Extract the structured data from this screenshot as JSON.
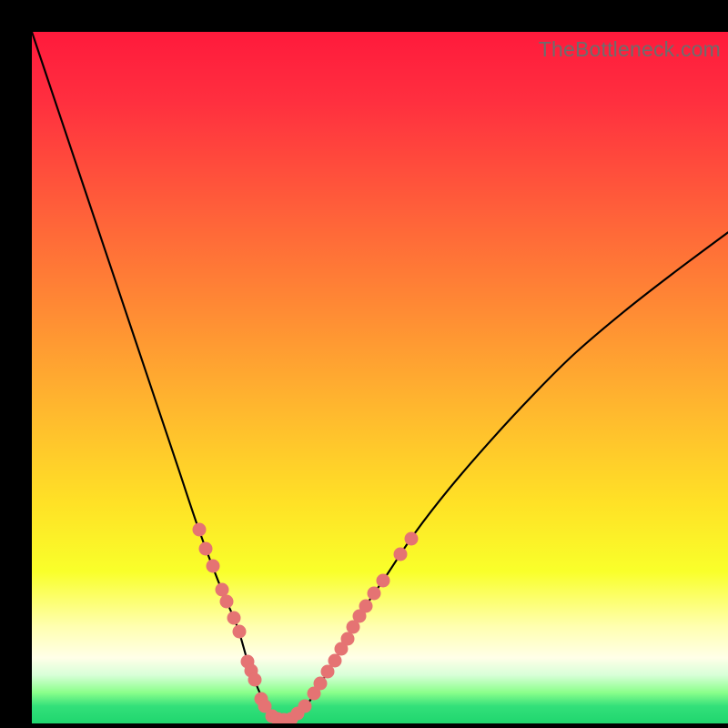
{
  "watermark": "TheBottleneck.com",
  "colors": {
    "frame_bg": "#000000",
    "curve": "#000000",
    "dot": "#e57373",
    "gradient_stops": [
      {
        "pos": 0.0,
        "color": "#ff1a3c"
      },
      {
        "pos": 0.1,
        "color": "#ff2f3f"
      },
      {
        "pos": 0.25,
        "color": "#ff5d3a"
      },
      {
        "pos": 0.4,
        "color": "#ff8a34"
      },
      {
        "pos": 0.55,
        "color": "#ffb92e"
      },
      {
        "pos": 0.68,
        "color": "#ffe126"
      },
      {
        "pos": 0.78,
        "color": "#f9ff2a"
      },
      {
        "pos": 0.86,
        "color": "#ffffb0"
      },
      {
        "pos": 0.905,
        "color": "#ffffe8"
      },
      {
        "pos": 0.93,
        "color": "#d8ffd8"
      },
      {
        "pos": 0.955,
        "color": "#8cff8c"
      },
      {
        "pos": 0.975,
        "color": "#33e07a"
      },
      {
        "pos": 1.0,
        "color": "#1fd66e"
      }
    ]
  },
  "chart_data": {
    "type": "line",
    "title": "",
    "xlabel": "",
    "ylabel": "",
    "xlim": [
      0,
      100
    ],
    "ylim": [
      0,
      100
    ],
    "note": "Axis values are normalized percentages of the plot area; the source figure has no numeric tick labels.",
    "series": [
      {
        "name": "bottleneck-curve",
        "x": [
          0,
          3,
          6,
          9,
          12,
          15,
          18,
          21,
          24,
          27,
          29.5,
          31,
          32.5,
          34,
          35.5,
          37,
          39,
          41,
          44,
          47,
          51,
          55,
          60,
          66,
          72,
          78,
          85,
          92,
          100
        ],
        "y": [
          100,
          91,
          82,
          73,
          64,
          55,
          46,
          37,
          28,
          20,
          14,
          9,
          5,
          2,
          0.5,
          0.5,
          2,
          5,
          10,
          15.5,
          21.5,
          27.5,
          34,
          41,
          47.5,
          53.5,
          59.5,
          65,
          71
        ]
      }
    ],
    "scatter": {
      "name": "highlighted-points",
      "points": [
        {
          "x": 24.0,
          "y": 28.0
        },
        {
          "x": 25.0,
          "y": 25.3
        },
        {
          "x": 26.0,
          "y": 22.7
        },
        {
          "x": 27.3,
          "y": 19.4
        },
        {
          "x": 28.0,
          "y": 17.6
        },
        {
          "x": 29.0,
          "y": 15.2
        },
        {
          "x": 29.8,
          "y": 13.3
        },
        {
          "x": 31.0,
          "y": 9.0
        },
        {
          "x": 31.5,
          "y": 7.6
        },
        {
          "x": 32.0,
          "y": 6.3
        },
        {
          "x": 33.0,
          "y": 3.5
        },
        {
          "x": 33.5,
          "y": 2.5
        },
        {
          "x": 34.5,
          "y": 1.0
        },
        {
          "x": 35.3,
          "y": 0.6
        },
        {
          "x": 36.2,
          "y": 0.5
        },
        {
          "x": 37.2,
          "y": 0.7
        },
        {
          "x": 38.2,
          "y": 1.5
        },
        {
          "x": 39.2,
          "y": 2.5
        },
        {
          "x": 40.5,
          "y": 4.3
        },
        {
          "x": 41.5,
          "y": 5.8
        },
        {
          "x": 42.5,
          "y": 7.5
        },
        {
          "x": 43.5,
          "y": 9.1
        },
        {
          "x": 44.5,
          "y": 10.8
        },
        {
          "x": 45.3,
          "y": 12.2
        },
        {
          "x": 46.2,
          "y": 14.0
        },
        {
          "x": 47.0,
          "y": 15.5
        },
        {
          "x": 48.0,
          "y": 17.0
        },
        {
          "x": 49.2,
          "y": 18.8
        },
        {
          "x": 50.5,
          "y": 20.7
        },
        {
          "x": 53.0,
          "y": 24.5
        },
        {
          "x": 54.5,
          "y": 26.7
        }
      ]
    }
  }
}
